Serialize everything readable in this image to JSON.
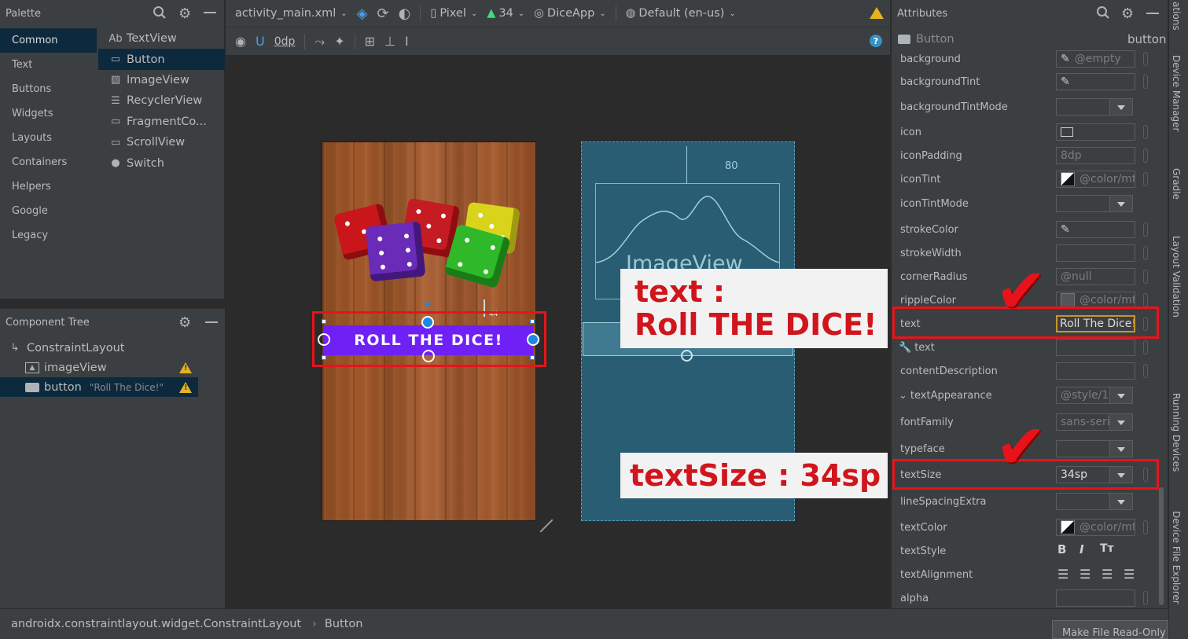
{
  "palette": {
    "title": "Palette",
    "categories": [
      "Common",
      "Text",
      "Buttons",
      "Widgets",
      "Layouts",
      "Containers",
      "Helpers",
      "Google",
      "Legacy"
    ],
    "items": [
      {
        "label": "TextView",
        "icon": "Ab"
      },
      {
        "label": "Button",
        "icon": "▭"
      },
      {
        "label": "ImageView",
        "icon": "▨"
      },
      {
        "label": "RecyclerView",
        "icon": "☰"
      },
      {
        "label": "FragmentCo...",
        "icon": "▭"
      },
      {
        "label": "ScrollView",
        "icon": "▭"
      },
      {
        "label": "Switch",
        "icon": "●"
      }
    ]
  },
  "tree": {
    "title": "Component Tree",
    "root": "ConstraintLayout",
    "image_view": "imageView",
    "button": "button",
    "button_text": "\"Roll The Dice!\""
  },
  "toolbar": {
    "file": "activity_main.xml",
    "device": "Pixel",
    "api": "34",
    "theme": "DiceApp",
    "locale": "Default (en-us)",
    "margin": "0dp"
  },
  "canvas": {
    "button_label": "ROLL THE DICE!",
    "blueprint_image_label": "ImageView",
    "margin_top": "80",
    "margin_small": "44"
  },
  "callouts": {
    "text_line1": "text :",
    "text_line2": "Roll THE DICE!",
    "size": "textSize : 34sp"
  },
  "attributes": {
    "title": "Attributes",
    "widget_type": "Button",
    "widget_id": "button",
    "rows": [
      {
        "label": "background",
        "value": "@empty"
      },
      {
        "label": "backgroundTint",
        "value": ""
      },
      {
        "label": "backgroundTintMode",
        "value": ""
      },
      {
        "label": "icon",
        "value": ""
      },
      {
        "label": "iconPadding",
        "value": "8dp"
      },
      {
        "label": "iconTint",
        "value": "@color/mt"
      },
      {
        "label": "iconTintMode",
        "value": ""
      },
      {
        "label": "strokeColor",
        "value": ""
      },
      {
        "label": "strokeWidth",
        "value": ""
      },
      {
        "label": "cornerRadius",
        "value": "@null"
      },
      {
        "label": "rippleColor",
        "value": "@color/mt"
      },
      {
        "label": "text",
        "value": "Roll The Dice!"
      },
      {
        "label": "text",
        "value": ""
      },
      {
        "label": "contentDescription",
        "value": ""
      },
      {
        "label": "textAppearance",
        "value": "@style/1"
      },
      {
        "label": "fontFamily",
        "value": "sans-seri"
      },
      {
        "label": "typeface",
        "value": ""
      },
      {
        "label": "textSize",
        "value": "34sp"
      },
      {
        "label": "lineSpacingExtra",
        "value": ""
      },
      {
        "label": "textColor",
        "value": "@color/mt"
      },
      {
        "label": "textStyle",
        "value": ""
      },
      {
        "label": "textAlignment",
        "value": ""
      },
      {
        "label": "alpha",
        "value": ""
      }
    ]
  },
  "sidetabs": [
    "ations",
    "Device Manager",
    "Gradle",
    "Layout Validation",
    "Running Devices",
    "Device File Explorer"
  ],
  "status": {
    "breadcrumb_root": "androidx.constraintlayout.widget.ConstraintLayout",
    "breadcrumb_leaf": "Button",
    "tooltip": "Make File Read-Only"
  }
}
